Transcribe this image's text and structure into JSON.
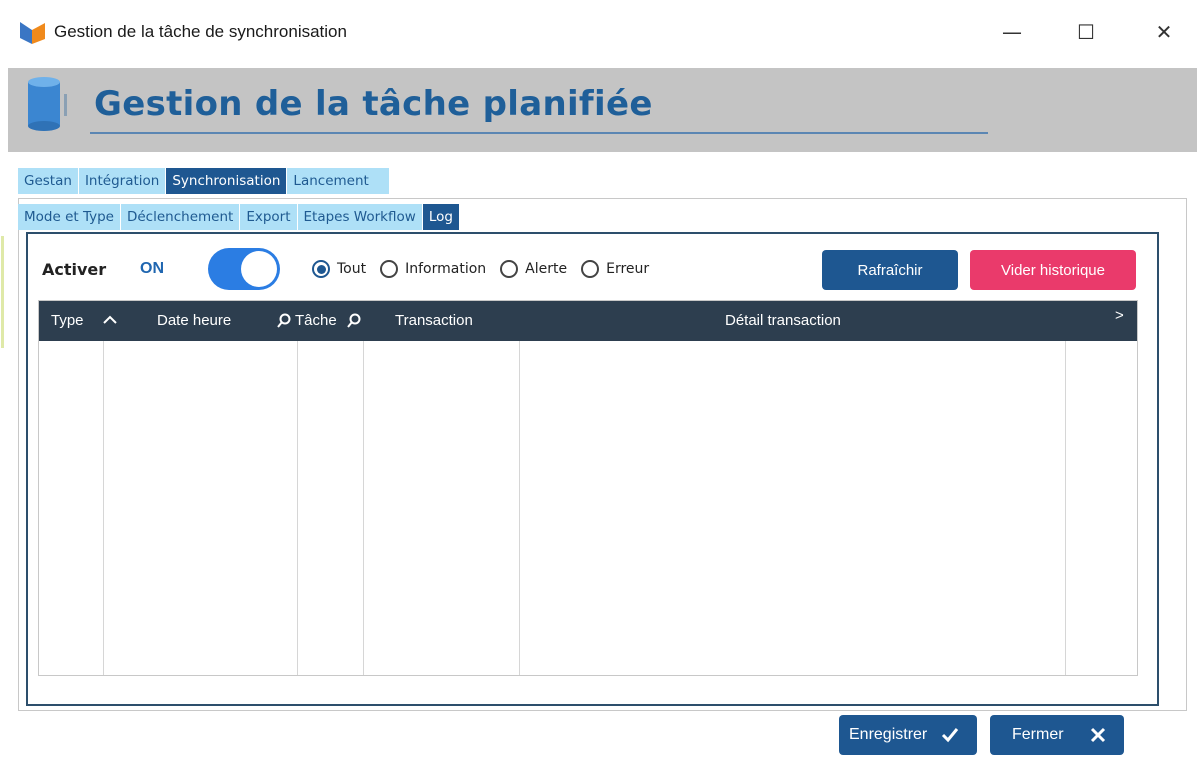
{
  "window": {
    "title": "Gestion de la tâche de synchronisation",
    "controls": {
      "minimize": "—",
      "maximize": "☐",
      "close": "✕"
    }
  },
  "banner": {
    "title": "Gestion de la tâche planifiée"
  },
  "tabs_top": [
    {
      "label": "Gestan",
      "active": false
    },
    {
      "label": "Intégration",
      "active": false
    },
    {
      "label": "Synchronisation",
      "active": true
    },
    {
      "label": "Lancement",
      "active": false
    }
  ],
  "tabs_sub": [
    {
      "label": "Mode et Type",
      "active": false
    },
    {
      "label": "Déclenchement",
      "active": false
    },
    {
      "label": "Export",
      "active": false
    },
    {
      "label": "Etapes Workflow",
      "active": false
    },
    {
      "label": "Log",
      "active": true
    }
  ],
  "log": {
    "activer_label": "Activer",
    "toggle_state": "ON",
    "filters": [
      {
        "label": "Tout",
        "checked": true
      },
      {
        "label": "Information",
        "checked": false
      },
      {
        "label": "Alerte",
        "checked": false
      },
      {
        "label": "Erreur",
        "checked": false
      }
    ],
    "refresh_label": "Rafraîchir",
    "clear_label": "Vider historique",
    "columns": {
      "type": "Type",
      "date": "Date heure",
      "task": "Tâche",
      "transaction": "Transaction",
      "detail": "Détail transaction"
    },
    "more_columns_icon": ">",
    "rows": []
  },
  "footer": {
    "save_label": "Enregistrer",
    "close_label": "Fermer"
  },
  "colors": {
    "primary": "#1e5791",
    "accent": "#ea3a6b",
    "tab_inactive": "#aee0f7",
    "grid_header": "#2d3e4f",
    "toggle_on": "#2b7de3"
  }
}
